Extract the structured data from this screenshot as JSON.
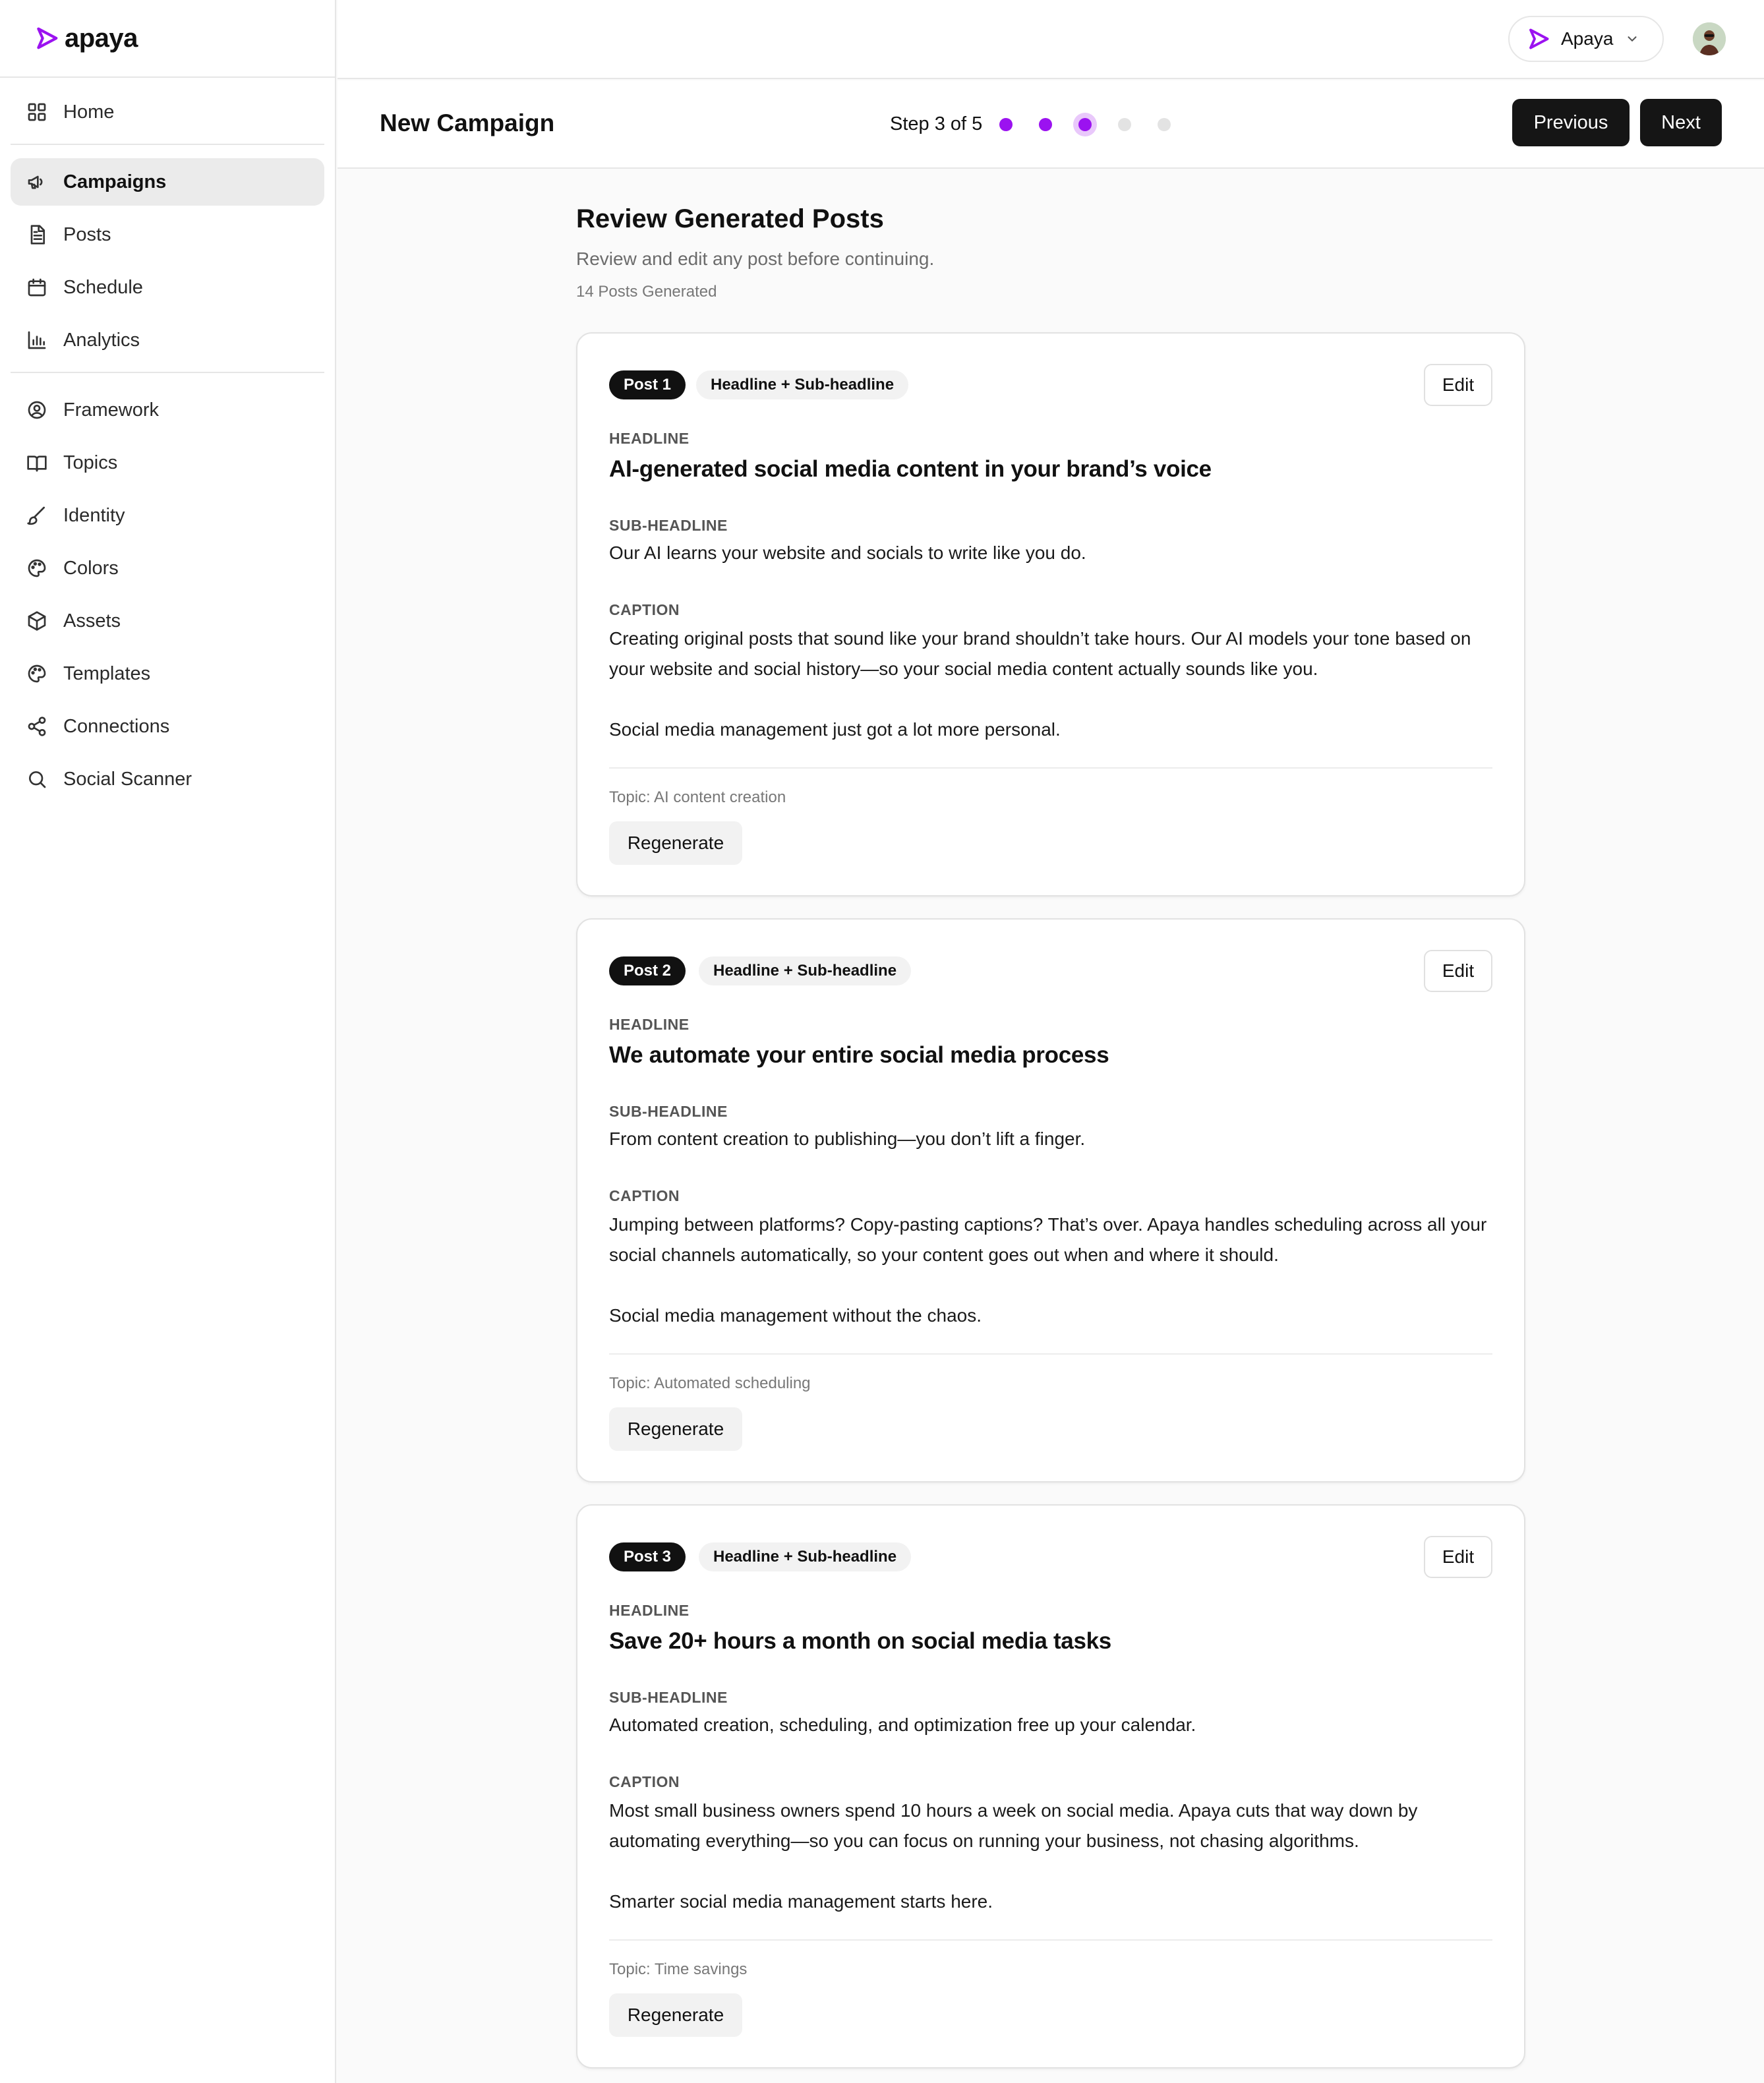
{
  "brand": {
    "name": "apaya",
    "accent": "#9b12f0"
  },
  "sidebar": {
    "items": [
      {
        "label": "Home",
        "icon": "grid-icon"
      },
      {
        "label": "Campaigns",
        "icon": "megaphone-icon",
        "active": true
      },
      {
        "label": "Posts",
        "icon": "document-icon"
      },
      {
        "label": "Schedule",
        "icon": "calendar-icon"
      },
      {
        "label": "Analytics",
        "icon": "bar-chart-icon"
      },
      {
        "label": "Framework",
        "icon": "user-circle-icon"
      },
      {
        "label": "Topics",
        "icon": "book-icon"
      },
      {
        "label": "Identity",
        "icon": "brush-icon"
      },
      {
        "label": "Colors",
        "icon": "palette-icon"
      },
      {
        "label": "Assets",
        "icon": "box-icon"
      },
      {
        "label": "Templates",
        "icon": "palette-icon"
      },
      {
        "label": "Connections",
        "icon": "share-icon"
      },
      {
        "label": "Social Scanner",
        "icon": "search-icon"
      }
    ]
  },
  "topbar": {
    "workspace_name": "Apaya"
  },
  "wizard": {
    "title": "New Campaign",
    "step_label": "Step 3 of 5",
    "current_step": 3,
    "total_steps": 5,
    "previous_label": "Previous",
    "next_label": "Next"
  },
  "review": {
    "title": "Review Generated Posts",
    "subtitle": "Review and edit any post before continuing.",
    "count_label": "14 Posts Generated"
  },
  "labels": {
    "headline": "HEADLINE",
    "subheadline": "SUB-HEADLINE",
    "caption": "CAPTION",
    "edit": "Edit",
    "regenerate": "Regenerate"
  },
  "posts": [
    {
      "tag": "Post 1",
      "format": "Headline + Sub-headline",
      "headline": "AI-generated social media content in your brand’s voice",
      "subheadline": "Our AI learns your website and socials to write like you do.",
      "caption_1": "Creating original posts that sound like your brand shouldn’t take hours. Our AI models your tone based on your website and social history—so your social media content actually sounds like you.",
      "caption_2": "Social media management just got a lot more personal.",
      "topic": "Topic: AI content creation"
    },
    {
      "tag": "Post 2",
      "format": "Headline + Sub-headline",
      "headline": "We automate your entire social media process",
      "subheadline": "From content creation to publishing—you don’t lift a finger.",
      "caption_1": "Jumping between platforms? Copy-pasting captions? That’s over. Apaya handles scheduling across all your social channels automatically, so your content goes out when and where it should.",
      "caption_2": "Social media management without the chaos.",
      "topic": "Topic: Automated scheduling"
    },
    {
      "tag": "Post 3",
      "format": "Headline + Sub-headline",
      "headline": "Save 20+ hours a month on social media tasks",
      "subheadline": "Automated creation, scheduling, and optimization free up your calendar.",
      "caption_1": "Most small business owners spend 10 hours a week on social media. Apaya cuts that way down by automating everything—so you can focus on running your business, not chasing algorithms.",
      "caption_2": "Smarter social media management starts here.",
      "topic": "Topic: Time savings"
    }
  ]
}
